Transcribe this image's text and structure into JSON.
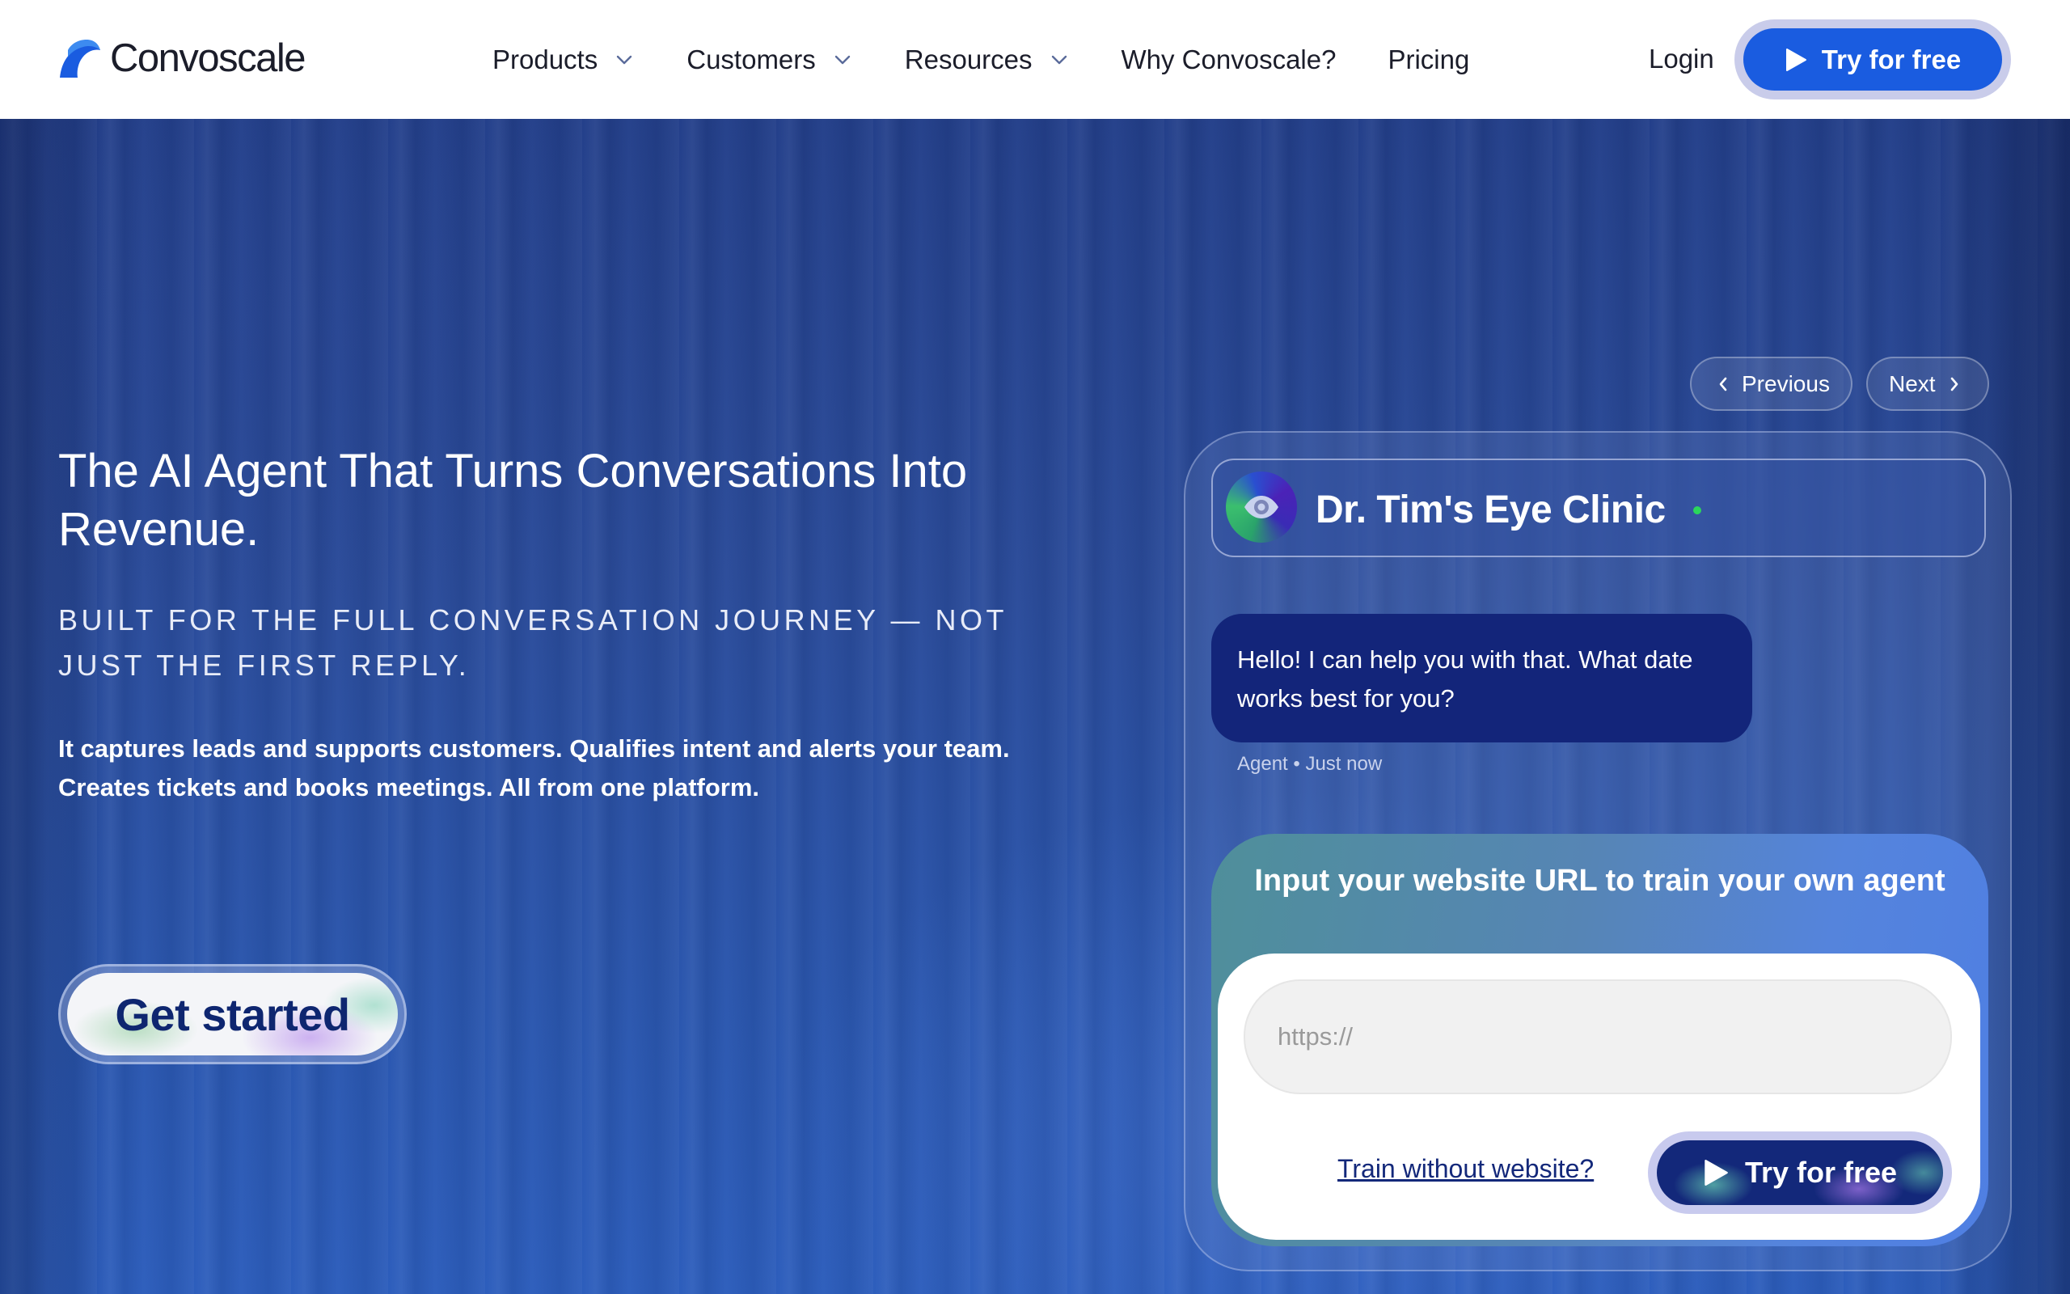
{
  "brand": {
    "name": "Convoscale",
    "accent_color": "#1a5ce0",
    "dark_color": "#13287a"
  },
  "nav": {
    "items": [
      {
        "label": "Products",
        "has_dropdown": true
      },
      {
        "label": "Customers",
        "has_dropdown": true
      },
      {
        "label": "Resources",
        "has_dropdown": true
      },
      {
        "label": "Why Convoscale?",
        "has_dropdown": false
      },
      {
        "label": "Pricing",
        "has_dropdown": false
      }
    ],
    "login_label": "Login",
    "cta_label": "Try for free"
  },
  "hero": {
    "headline": "The AI Agent That Turns Conversations Into Revenue.",
    "subhead": "BUILT FOR THE FULL CONVERSATION JOURNEY — NOT JUST THE FIRST REPLY.",
    "description": "It captures leads and supports customers. Qualifies intent and alerts your team. Creates tickets and books meetings. All from one platform.",
    "get_started_label": "Get started"
  },
  "demo": {
    "previous_label": "Previous",
    "next_label": "Next",
    "clinic_name": "Dr. Tim's Eye Clinic",
    "avatar_icon": "eye-icon",
    "status": "online",
    "message": "Hello! I can help you with that. What date works best for you?",
    "message_meta": "Agent • Just now",
    "train_title": "Input your website URL to train your own agent",
    "url_placeholder": "https://",
    "url_value": "",
    "train_without_label": "Train without website?",
    "cta_label": "Try for free"
  }
}
